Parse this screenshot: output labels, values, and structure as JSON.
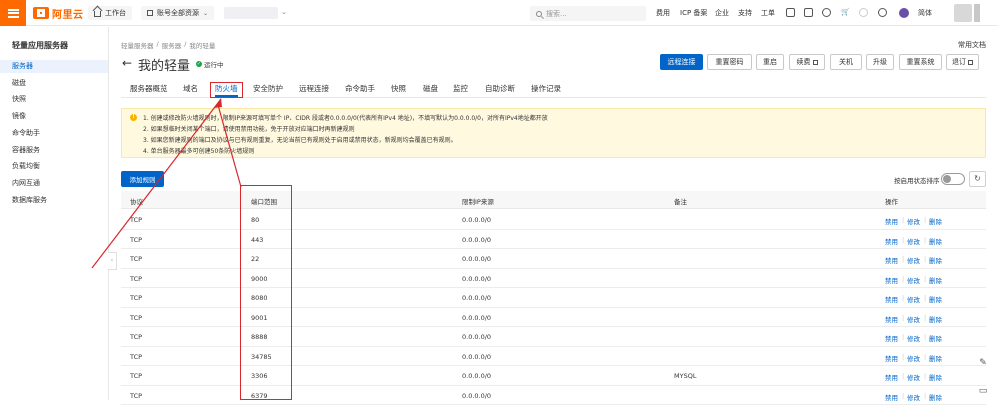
{
  "topbar": {
    "logo_text": "阿里云",
    "workbench": "工作台",
    "resource_selector": "账号全部资源",
    "search_placeholder": "搜索...",
    "nav": [
      "费用",
      "ICP 备案",
      "企业",
      "支持",
      "工单"
    ],
    "language": "简体",
    "accent_color": "#ff6a00"
  },
  "sidebar": {
    "title": "轻量应用服务器",
    "items": [
      {
        "label": "服务器",
        "active": true
      },
      {
        "label": "磁盘"
      },
      {
        "label": "快照"
      },
      {
        "label": "镜像"
      },
      {
        "label": "命令助手"
      },
      {
        "label": "容器服务"
      },
      {
        "label": "负载均衡"
      },
      {
        "label": "内网互通"
      },
      {
        "label": "数据库服务"
      }
    ],
    "collapse_glyph": "‹"
  },
  "header": {
    "breadcrumb": [
      "轻量服务器",
      "/",
      "服务器",
      "/",
      "我的轻量"
    ],
    "docs_link": "常用文档",
    "back_glyph": "←",
    "title": "我的轻量",
    "status": "运行中",
    "actions": [
      "远程连接",
      "重置密码",
      "重启",
      "续费",
      "关机",
      "升级",
      "重置系统",
      "退订"
    ]
  },
  "tabs": [
    "服务器概览",
    "域名",
    "防火墙",
    "安全防护",
    "远程连接",
    "命令助手",
    "快照",
    "磁盘",
    "监控",
    "自助诊断",
    "操作记录"
  ],
  "notice": {
    "icon": "!",
    "lines": [
      "1. 创建或修改防火墙规则时，限制IP来源可填写单个 IP、CIDR 段或者0.0.0.0/0(代表所有IPv4 地址)，不填写默认为0.0.0.0/0，对所有IPv4地址都开放",
      "2. 如果想临时关闭某个端口，请使用禁用功能，免于开放对应端口时再新建规则",
      "3. 如果您新建规则的端口及协议与已有规则重复，无论当前已有规则处于启用或禁用状态，新规则均会覆盖已有规则。",
      "4. 单台服务器最多可创建50条防火墙规则"
    ]
  },
  "toolbar": {
    "add_rule": "添加规则",
    "sort_label": "按启用状态排序",
    "refresh_glyph": "↻"
  },
  "table": {
    "headers": [
      "协议",
      "端口范围",
      "限制IP来源",
      "备注",
      "操作"
    ],
    "op_labels": [
      "禁用",
      "修改",
      "删除"
    ],
    "op_separator": "|",
    "rows": [
      {
        "protocol": "TCP",
        "port": "80",
        "source": "0.0.0.0/0",
        "note": ""
      },
      {
        "protocol": "TCP",
        "port": "443",
        "source": "0.0.0.0/0",
        "note": ""
      },
      {
        "protocol": "TCP",
        "port": "22",
        "source": "0.0.0.0/0",
        "note": ""
      },
      {
        "protocol": "TCP",
        "port": "9000",
        "source": "0.0.0.0/0",
        "note": ""
      },
      {
        "protocol": "TCP",
        "port": "8080",
        "source": "0.0.0.0/0",
        "note": ""
      },
      {
        "protocol": "TCP",
        "port": "9001",
        "source": "0.0.0.0/0",
        "note": ""
      },
      {
        "protocol": "TCP",
        "port": "8888",
        "source": "0.0.0.0/0",
        "note": ""
      },
      {
        "protocol": "TCP",
        "port": "34785",
        "source": "0.0.0.0/0",
        "note": ""
      },
      {
        "protocol": "TCP",
        "port": "3306",
        "source": "0.0.0.0/0",
        "note": "MYSQL"
      },
      {
        "protocol": "TCP",
        "port": "6379",
        "source": "0.0.0.0/0",
        "note": ""
      }
    ]
  },
  "annotation_color": "#d9272e"
}
